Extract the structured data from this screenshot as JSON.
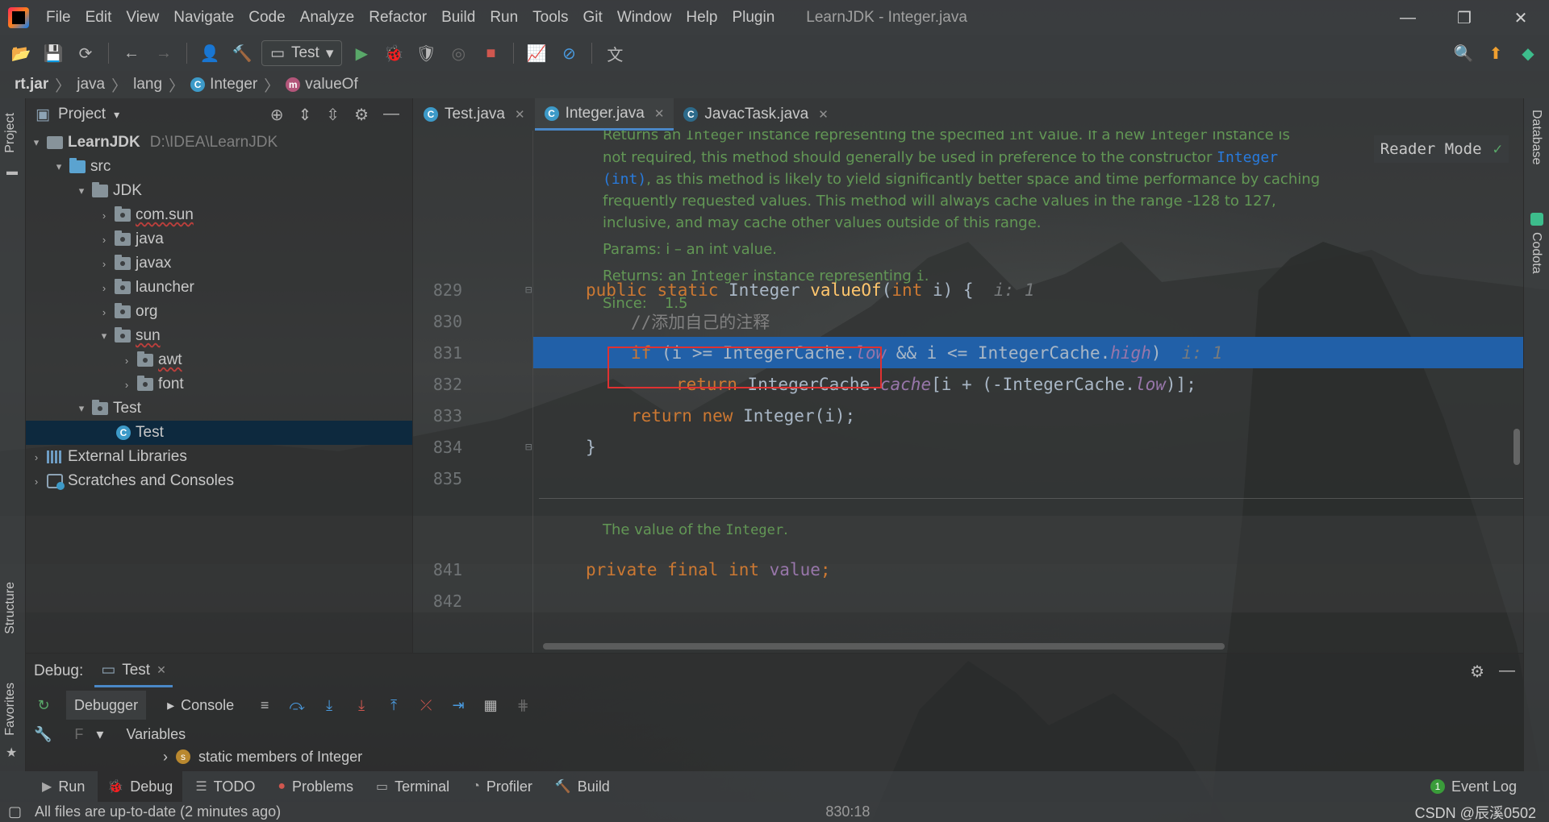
{
  "window": {
    "title": "LearnJDK - Integer.java",
    "menu": [
      "File",
      "Edit",
      "View",
      "Navigate",
      "Code",
      "Analyze",
      "Refactor",
      "Build",
      "Run",
      "Tools",
      "Git",
      "Window",
      "Help",
      "Plugin"
    ],
    "controls": {
      "minimize": "—",
      "restore": "❐",
      "close": "✕"
    }
  },
  "toolbar": {
    "run_config": "Test"
  },
  "breadcrumb": {
    "items": [
      "rt.jar",
      "java",
      "lang",
      "Integer",
      "valueOf"
    ]
  },
  "left_strip": {
    "project": "Project",
    "structure": "Structure",
    "favorites": "Favorites"
  },
  "project_panel": {
    "title": "Project",
    "tree": [
      {
        "label": "LearnJDK",
        "path": "D:\\IDEA\\LearnJDK"
      },
      {
        "label": "src"
      },
      {
        "label": "JDK"
      },
      {
        "label": "com.sun"
      },
      {
        "label": "java"
      },
      {
        "label": "javax"
      },
      {
        "label": "launcher"
      },
      {
        "label": "org"
      },
      {
        "label": "sun"
      },
      {
        "label": "awt"
      },
      {
        "label": "font"
      },
      {
        "label": "Test"
      },
      {
        "label": "Test"
      },
      {
        "label": "External Libraries"
      },
      {
        "label": "Scratches and Consoles"
      }
    ]
  },
  "editor": {
    "tabs": [
      {
        "label": "Test.java"
      },
      {
        "label": "Integer.java"
      },
      {
        "label": "JavacTask.java"
      }
    ],
    "reader_mode": "Reader Mode",
    "doc1": {
      "line1_pre": "Returns an ",
      "line1_code1": "Integer",
      "line1_mid": " instance representing the specified ",
      "line1_code2": "int",
      "line1_mid2": " value. If a new ",
      "line1_code3": "Integer",
      "line1_post": " instance is",
      "line2_pre": "not required, this method should generally be used in preference to the constructor ",
      "line2_link": "Integer",
      "line3_link": "(int)",
      "line3_post": ", as this method is likely to yield significantly better space and time performance by caching",
      "line4": "frequently requested values. This method will always cache values in the range -128 to 127,",
      "line5": "inclusive, and may cache other values outside of this range.",
      "params": "Params: i – an int value.",
      "returns_pre": "Returns: an ",
      "returns_code": "Integer",
      "returns_post": " instance representing ",
      "returns_code2": "i",
      "returns_end": ".",
      "since_label": "Since:",
      "since_value": "1.5"
    },
    "doc2": {
      "pre": "The value of the ",
      "code": "Integer",
      "post": "."
    },
    "lines": {
      "n829": "829",
      "n830": "830",
      "n831": "831",
      "n832": "832",
      "n833": "833",
      "n834": "834",
      "n835": "835",
      "n841": "841",
      "n842": "842",
      "l829_public": "public",
      "l829_static": "static",
      "l829_type": "Integer",
      "l829_fn": "valueOf",
      "l829_open": "(",
      "l829_int": "int",
      "l829_rest": " i) {",
      "l829_hint": "i: 1",
      "l830_comment": "//添加自己的注释",
      "l831_if": "if",
      "l831_a": " (i >= IntegerCache.",
      "l831_low": "low",
      "l831_b": " && i <= IntegerCache.",
      "l831_high": "high",
      "l831_c": ")",
      "l831_hint": "i: 1",
      "l832_return": "return",
      "l832_a": " IntegerCache.",
      "l832_cache": "cache",
      "l832_b": "[i + (-IntegerCache.",
      "l832_low": "low",
      "l832_c": ")];",
      "l833_return": "return",
      "l833_new": "new",
      "l833_rest": " Integer(i);",
      "l834_brace": "}",
      "l841_private": "private",
      "l841_final": "final",
      "l841_int": "int",
      "l841_value": "value",
      "l841_semi": ";"
    }
  },
  "right_strip": {
    "database": "Database",
    "codota": "Codota"
  },
  "debug": {
    "label": "Debug:",
    "session": "Test",
    "debugger": "Debugger",
    "console": "Console",
    "variables": "Variables",
    "frames_glyph": "F",
    "static_members": "static members of Integer"
  },
  "tool_windows": [
    {
      "label": "Run"
    },
    {
      "label": "Debug"
    },
    {
      "label": "TODO"
    },
    {
      "label": "Problems"
    },
    {
      "label": "Terminal"
    },
    {
      "label": "Profiler"
    },
    {
      "label": "Build"
    }
  ],
  "event_log": {
    "count": "1",
    "label": "Event Log"
  },
  "status": {
    "message": "All files are up-to-date (2 minutes ago)",
    "position": "830:18",
    "watermark": "CSDN @辰溪0502"
  }
}
